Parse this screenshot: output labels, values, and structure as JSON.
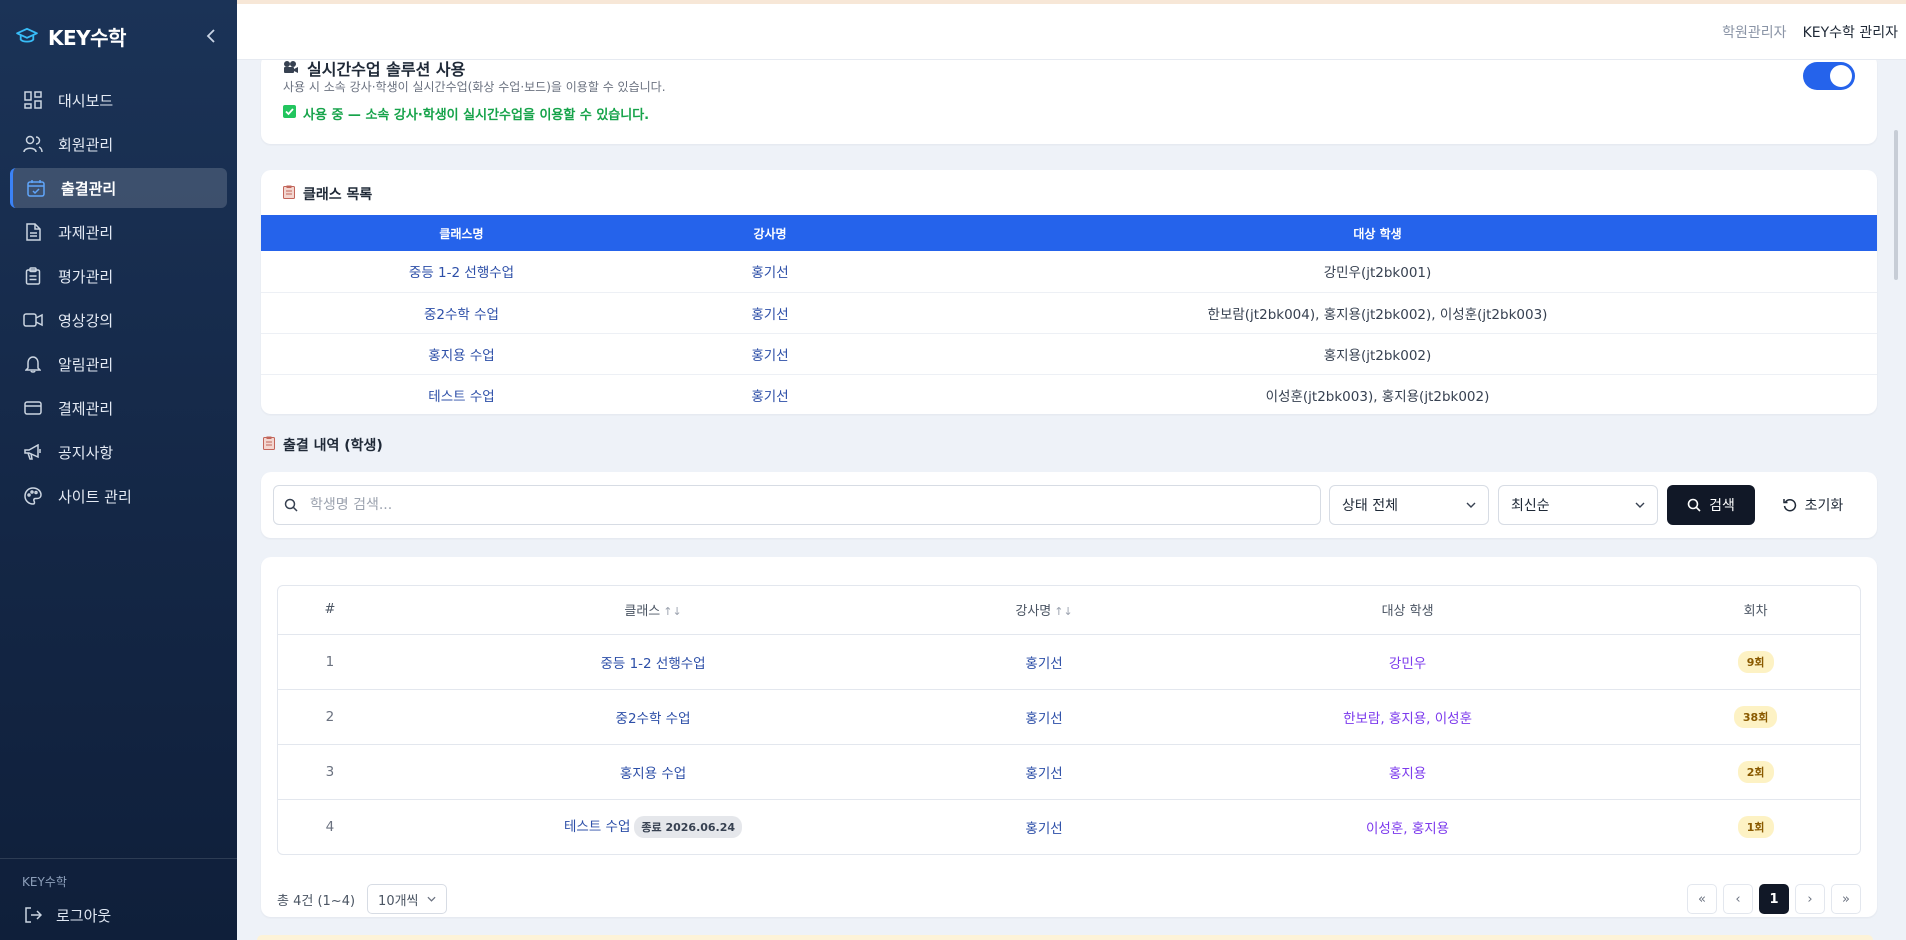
{
  "sidebar": {
    "brand": "KEY수학",
    "items": [
      {
        "label": "대시보드",
        "icon": "dashboard-icon"
      },
      {
        "label": "회원관리",
        "icon": "users-icon"
      },
      {
        "label": "출결관리",
        "icon": "calendar-check-icon",
        "active": true
      },
      {
        "label": "과제관리",
        "icon": "document-icon"
      },
      {
        "label": "평가관리",
        "icon": "clipboard-icon"
      },
      {
        "label": "영상강의",
        "icon": "video-icon"
      },
      {
        "label": "알림관리",
        "icon": "bell-icon"
      },
      {
        "label": "결제관리",
        "icon": "credit-card-icon"
      },
      {
        "label": "공지사항",
        "icon": "megaphone-icon"
      },
      {
        "label": "사이트 관리",
        "icon": "palette-icon"
      }
    ],
    "footer_org": "KEY수학",
    "logout": "로그아웃"
  },
  "topbar": {
    "role": "학원관리자",
    "user": "KEY수학 관리자"
  },
  "realtime": {
    "title": "실시간수업 솔루션 사용",
    "description": "사용 시 소속 강사·학생이 실시간수업(화상 수업·보드)을 이용할 수 있습니다.",
    "status": "사용 중 — 소속 강사·학생이 실시간수업을 이용할 수 있습니다.",
    "enabled": true
  },
  "class_list": {
    "title": "클래스 목록",
    "headers": [
      "클래스명",
      "강사명",
      "대상 학생"
    ],
    "rows": [
      [
        "중등 1-2 선행수업",
        "홍기선",
        "강민우(jt2bk001)"
      ],
      [
        "중2수학 수업",
        "홍기선",
        "한보람(jt2bk004), 홍지용(jt2bk002), 이성훈(jt2bk003)"
      ],
      [
        "홍지용 수업",
        "홍기선",
        "홍지용(jt2bk002)"
      ],
      [
        "테스트 수업",
        "홍기선",
        "이성훈(jt2bk003), 홍지용(jt2bk002)"
      ]
    ]
  },
  "attendance": {
    "title": "출결 내역 (학생)",
    "search_placeholder": "학생명 검색...",
    "status_filter": "상태 전체",
    "sort_filter": "최신순",
    "search_btn": "검색",
    "reset_btn": "초기화",
    "headers": [
      "#",
      "클래스",
      "강사명",
      "대상 학생",
      "회차"
    ],
    "sort_mark": "↑↓",
    "rows": [
      {
        "no": "1",
        "class": "중등 1-2 선행수업",
        "tag": "",
        "teacher": "홍기선",
        "students": "강민우",
        "session": "9회"
      },
      {
        "no": "2",
        "class": "중2수학 수업",
        "tag": "",
        "teacher": "홍기선",
        "students": "한보람, 홍지용, 이성훈",
        "session": "38회"
      },
      {
        "no": "3",
        "class": "홍지용 수업",
        "tag": "",
        "teacher": "홍기선",
        "students": "홍지용",
        "session": "2회"
      },
      {
        "no": "4",
        "class": "테스트 수업",
        "tag": "종료 2026.06.24",
        "teacher": "홍기선",
        "students": "이성훈, 홍지용",
        "session": "1회"
      }
    ],
    "total": "총 4건 (1~4)",
    "page_size": "10개씩",
    "pager": {
      "first": "«",
      "prev": "‹",
      "current": "1",
      "next": "›",
      "last": "»"
    }
  }
}
